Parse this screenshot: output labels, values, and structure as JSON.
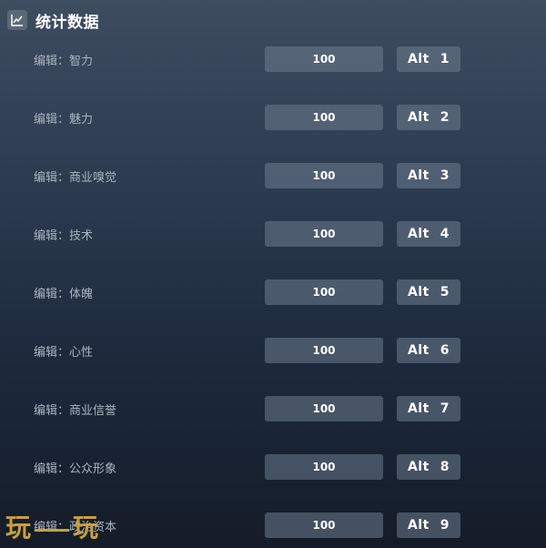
{
  "header": {
    "title": "统计数据",
    "icon": "chart-line-icon"
  },
  "rows": [
    {
      "label": "编辑：智力",
      "value": "100",
      "hotkey_mod": "Alt",
      "hotkey_key": "1"
    },
    {
      "label": "编辑：魅力",
      "value": "100",
      "hotkey_mod": "Alt",
      "hotkey_key": "2"
    },
    {
      "label": "编辑：商业嗅觉",
      "value": "100",
      "hotkey_mod": "Alt",
      "hotkey_key": "3"
    },
    {
      "label": "编辑：技术",
      "value": "100",
      "hotkey_mod": "Alt",
      "hotkey_key": "4"
    },
    {
      "label": "编辑：体魄",
      "value": "100",
      "hotkey_mod": "Alt",
      "hotkey_key": "5"
    },
    {
      "label": "编辑：心性",
      "value": "100",
      "hotkey_mod": "Alt",
      "hotkey_key": "6"
    },
    {
      "label": "编辑：商业信誉",
      "value": "100",
      "hotkey_mod": "Alt",
      "hotkey_key": "7"
    },
    {
      "label": "编辑：公众形象",
      "value": "100",
      "hotkey_mod": "Alt",
      "hotkey_key": "8"
    },
    {
      "label": "编辑：政治资本",
      "value": "100",
      "hotkey_mod": "Alt",
      "hotkey_key": "9"
    }
  ],
  "watermark": {
    "left_char": "玩",
    "right_char": "玩",
    "color": "#c9a03a"
  }
}
